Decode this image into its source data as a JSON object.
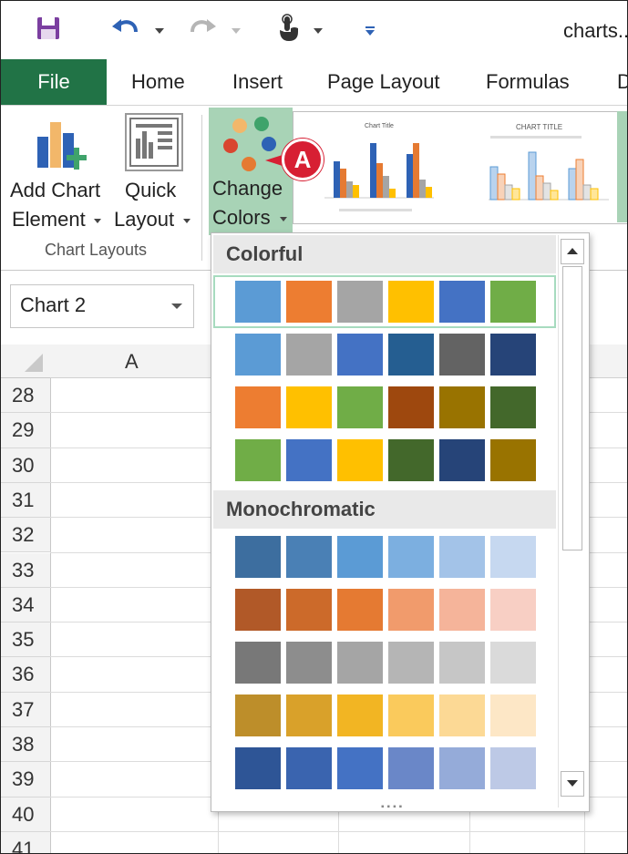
{
  "window": {
    "title": "charts.."
  },
  "tabs": {
    "file": "File",
    "home": "Home",
    "insert": "Insert",
    "page_layout": "Page Layout",
    "formulas": "Formulas",
    "data": "D"
  },
  "ribbon": {
    "add_chart_element": {
      "line1": "Add Chart",
      "line2": "Element"
    },
    "quick_layout": {
      "line1": "Quick",
      "line2": "Layout"
    },
    "change_colors": {
      "line1": "Change",
      "line2": "Colors"
    },
    "group_label": "Chart Layouts",
    "thumb1_title": "Chart Title",
    "thumb2_title": "CHART TITLE"
  },
  "callout": "A",
  "namebox": {
    "value": "Chart 2"
  },
  "sheet": {
    "col_a": "A",
    "rows": [
      "28",
      "29",
      "30",
      "31",
      "32",
      "33",
      "34",
      "35",
      "36",
      "37",
      "38",
      "39",
      "40",
      "41"
    ]
  },
  "dropdown": {
    "colorful_label": "Colorful",
    "monochromatic_label": "Monochromatic",
    "colorful": [
      [
        "#5B9BD5",
        "#ED7D31",
        "#A5A5A5",
        "#FFC000",
        "#4472C4",
        "#70AD47"
      ],
      [
        "#5B9BD5",
        "#A5A5A5",
        "#4472C4",
        "#255E91",
        "#636363",
        "#264478"
      ],
      [
        "#ED7D31",
        "#FFC000",
        "#70AD47",
        "#9E480E",
        "#997300",
        "#43682B"
      ],
      [
        "#70AD47",
        "#4472C4",
        "#FFC000",
        "#43682B",
        "#264478",
        "#997300"
      ]
    ],
    "monochromatic": [
      [
        "#3D6E9F",
        "#4A80B5",
        "#5B9BD5",
        "#7CAFE0",
        "#A3C3E8",
        "#C6D8F0"
      ],
      [
        "#B15928",
        "#CC6A2A",
        "#E57A32",
        "#F19B6C",
        "#F5B49A",
        "#F8CFC4"
      ],
      [
        "#787878",
        "#8D8D8D",
        "#A5A5A5",
        "#B5B5B5",
        "#C6C6C6",
        "#DADADA"
      ],
      [
        "#BD8E2A",
        "#D9A12A",
        "#F2B523",
        "#FACA5C",
        "#FCD995",
        "#FDE7C6"
      ],
      [
        "#2E5596",
        "#3A64AF",
        "#4472C4",
        "#6A87C8",
        "#95ABD9",
        "#BDC9E6"
      ]
    ]
  }
}
